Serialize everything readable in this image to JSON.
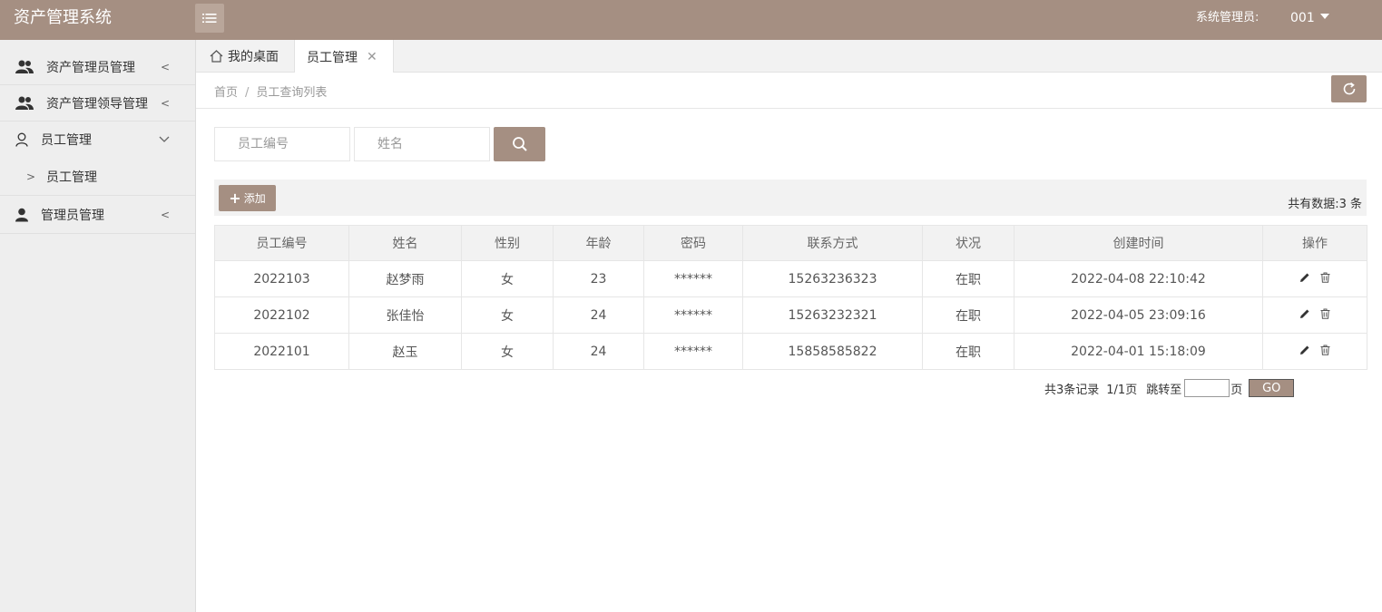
{
  "header": {
    "app_title": "资产管理系统",
    "admin_label": "系统管理员:",
    "admin_user": "001"
  },
  "sidebar": {
    "items": [
      {
        "label": "资产管理员管理",
        "icon": "users-icon"
      },
      {
        "label": "资产管理领导管理",
        "icon": "users-icon"
      },
      {
        "label": "员工管理",
        "icon": "user-outline-icon",
        "expanded": true
      },
      {
        "label": "员工管理",
        "icon": "chevron-right-icon",
        "sub": true
      },
      {
        "label": "管理员管理",
        "icon": "user-icon"
      }
    ]
  },
  "tabs": [
    {
      "label": "我的桌面",
      "icon": "home-icon"
    },
    {
      "label": "员工管理",
      "active": true
    }
  ],
  "breadcrumb": {
    "home": "首页",
    "sep": "/",
    "current": "员工查询列表"
  },
  "search": {
    "emp_no_placeholder": "员工编号",
    "name_placeholder": "姓名"
  },
  "toolbar": {
    "add_label": "添加",
    "total_text": "共有数据:3 条"
  },
  "table": {
    "headers": [
      "员工编号",
      "姓名",
      "性别",
      "年龄",
      "密码",
      "联系方式",
      "状况",
      "创建时间",
      "操作"
    ],
    "rows": [
      [
        "2022103",
        "赵梦雨",
        "女",
        "23",
        "******",
        "15263236323",
        "在职",
        "2022-04-08 22:10:42"
      ],
      [
        "2022102",
        "张佳怡",
        "女",
        "24",
        "******",
        "15263232321",
        "在职",
        "2022-04-05 23:09:16"
      ],
      [
        "2022101",
        "赵玉",
        "女",
        "24",
        "******",
        "15858585822",
        "在职",
        "2022-04-01 15:18:09"
      ]
    ]
  },
  "pagination": {
    "records": "共3条记录",
    "pages": "1/1页",
    "jump_to": "跳转至",
    "page_suffix": "页",
    "go": "GO"
  },
  "colors": {
    "brand": "#a58f82"
  }
}
